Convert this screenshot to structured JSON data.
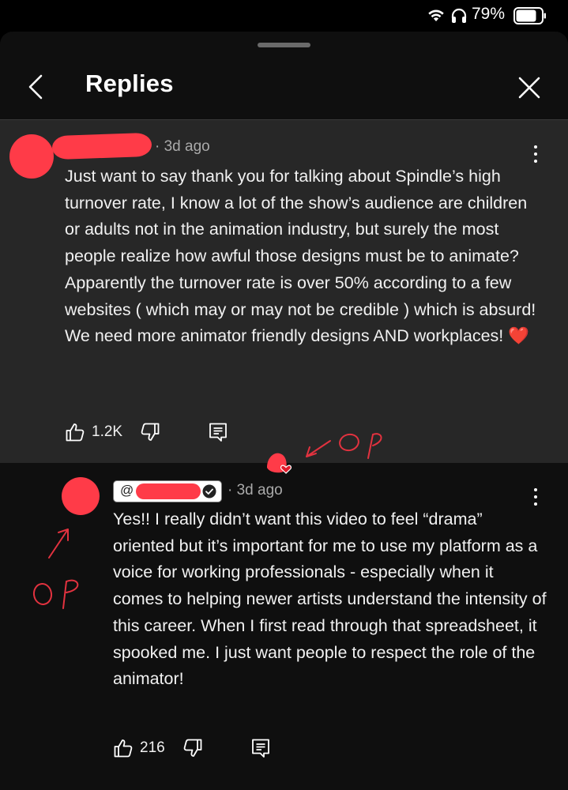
{
  "status_bar": {
    "battery_percent": "79%",
    "icons": [
      "wifi-icon",
      "headphones-icon",
      "battery-icon"
    ]
  },
  "header": {
    "title": "Replies",
    "back_icon": "chevron-left-icon",
    "close_icon": "close-icon"
  },
  "parent_comment": {
    "time": "· 3d ago",
    "text": "Just want to say thank you for talking about Spindle’s high turnover rate, I know a lot of the show’s audience are children or adults not in the animation industry, but surely the most people realize how awful those designs must be to animate? Apparently the turnover rate is over 50% according to a few websites ( which may or may not be credible ) which is absurd! We need more animator friendly designs AND workplaces! ❤️",
    "likes": "1.2K",
    "annotation": "OP"
  },
  "reply": {
    "handle_prefix": "@",
    "time": "· 3d ago",
    "text": "Yes!! I really didn’t want this video to feel “drama” oriented but it’s important for me to use my platform as a voice for working professionals - especially when it comes to helping newer artists understand the intensity of this career. When I first read through that spreadsheet, it spooked me. I just want people to respect the role of the animator!",
    "likes": "216",
    "annotation": "OP"
  },
  "colors": {
    "background": "#0f0f0f",
    "parent_background": "#272727",
    "redaction": "#ff3b48",
    "annotation": "#e2323f",
    "meta_text": "#aaaaaa"
  }
}
